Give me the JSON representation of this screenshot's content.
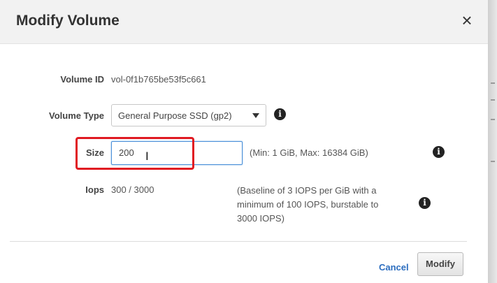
{
  "dialog": {
    "title": "Modify Volume",
    "close_label": "×"
  },
  "volume_id": {
    "label": "Volume ID",
    "value": "vol-0f1b765be53f5c661"
  },
  "volume_type": {
    "label": "Volume Type",
    "selected": "General Purpose SSD (gp2)"
  },
  "size": {
    "label": "Size",
    "value": "200",
    "hint": "(Min: 1 GiB, Max: 16384 GiB)"
  },
  "iops": {
    "label": "Iops",
    "value": "300 / 3000",
    "hint_lines": [
      "(Baseline of 3 IOPS per GiB with a",
      "minimum of 100 IOPS, burstable to",
      "3000 IOPS)"
    ]
  },
  "icons": {
    "info": "info-icon",
    "info_glyph": "i"
  },
  "footer": {
    "cancel_label": "Cancel",
    "modify_label": "Modify"
  },
  "colors": {
    "accent": "#2b6dbf",
    "highlight": "#e01a22",
    "focus": "#4a90d9"
  }
}
